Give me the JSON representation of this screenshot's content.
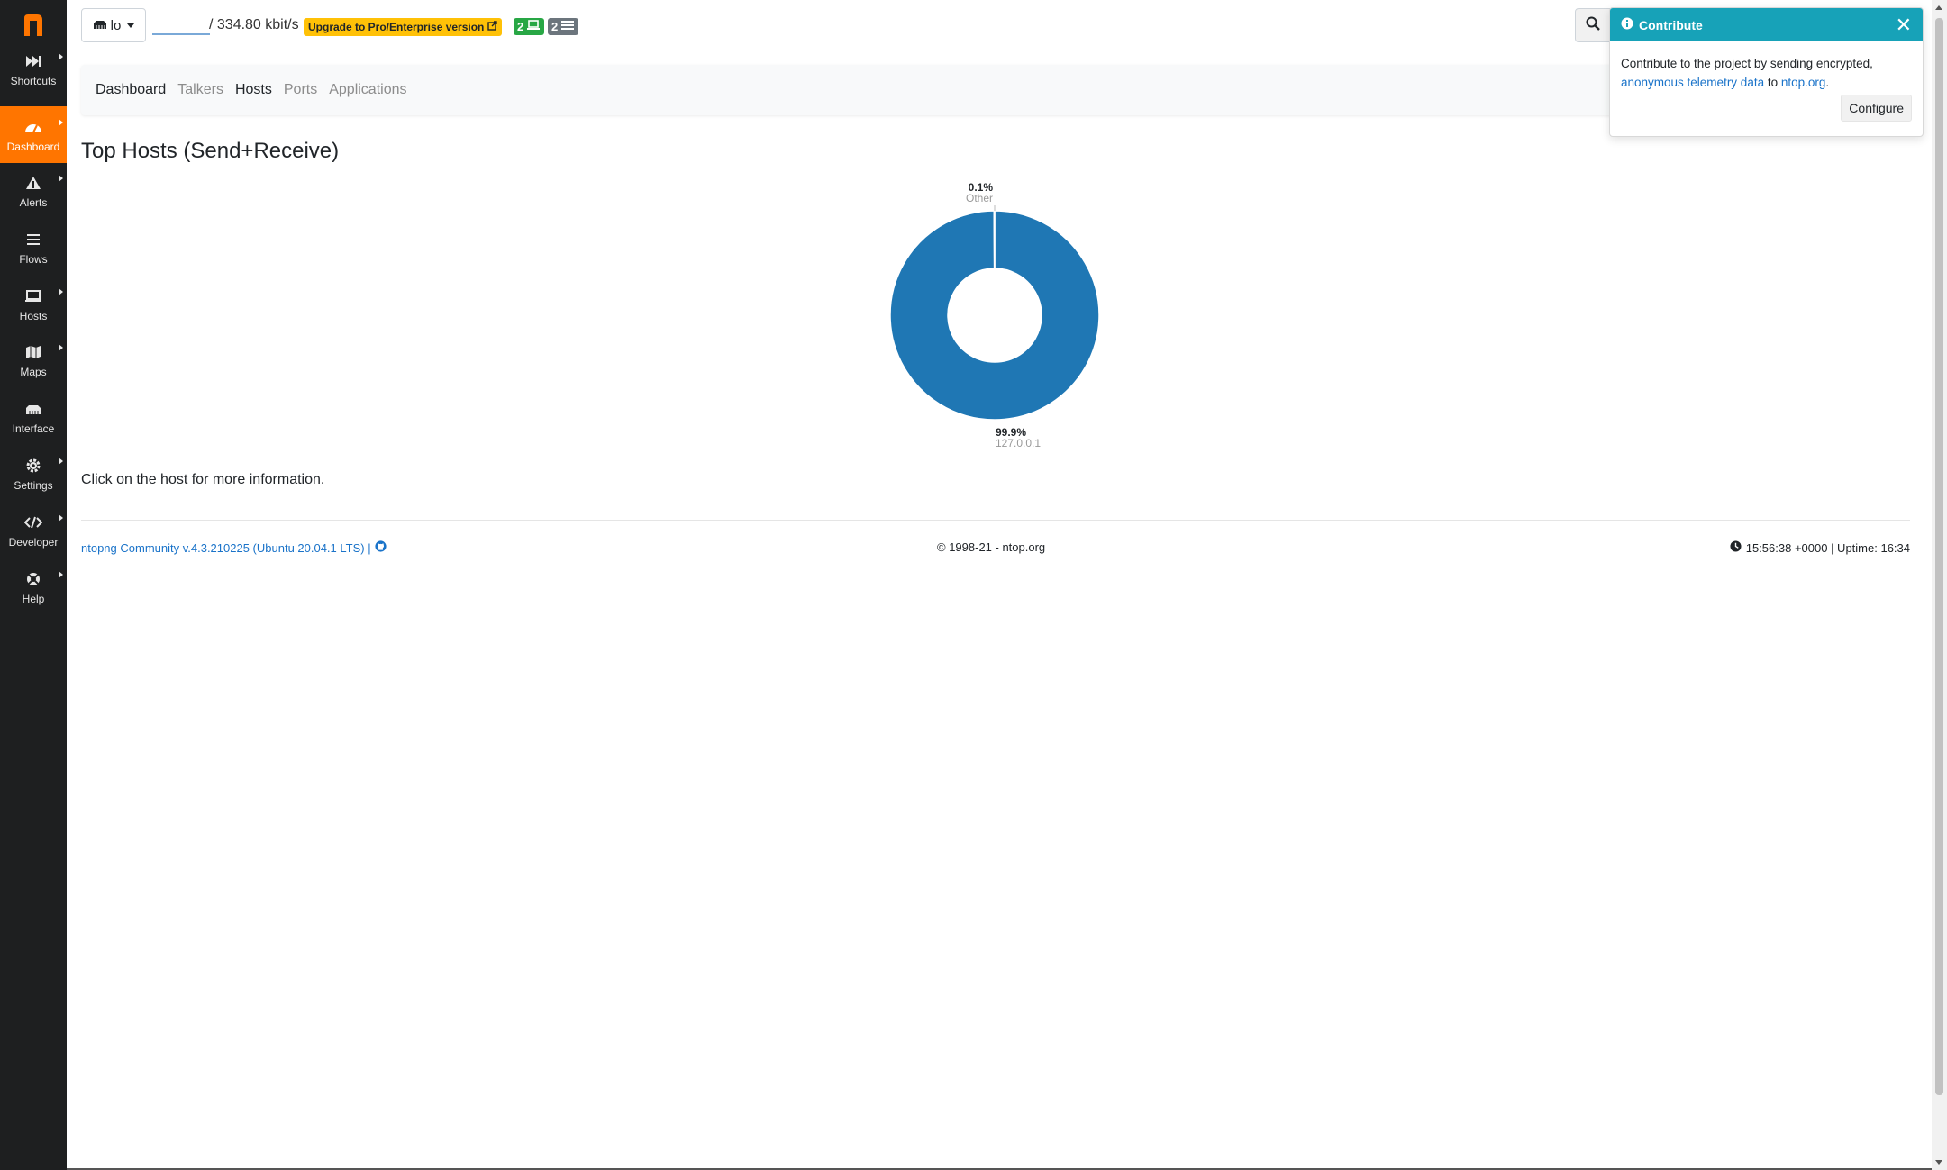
{
  "sidebar": {
    "logo": "n",
    "items": [
      {
        "label": "Shortcuts",
        "icon": "fast-forward-icon",
        "caret": true,
        "active": false
      },
      {
        "label": "Dashboard",
        "icon": "gauge-icon",
        "caret": true,
        "active": true
      },
      {
        "label": "Alerts",
        "icon": "warning-icon",
        "caret": true,
        "active": false
      },
      {
        "label": "Flows",
        "icon": "list-icon",
        "caret": false,
        "active": false
      },
      {
        "label": "Hosts",
        "icon": "laptop-icon",
        "caret": true,
        "active": false
      },
      {
        "label": "Maps",
        "icon": "map-icon",
        "caret": true,
        "active": false
      },
      {
        "label": "Interface",
        "icon": "ethernet-icon",
        "caret": false,
        "active": false
      },
      {
        "label": "Settings",
        "icon": "gear-icon",
        "caret": true,
        "active": false
      },
      {
        "label": "Developer",
        "icon": "code-icon",
        "caret": true,
        "active": false
      },
      {
        "label": "Help",
        "icon": "lifebuoy-icon",
        "caret": true,
        "active": false
      }
    ]
  },
  "topbar": {
    "interface_name": "lo",
    "throughput": "/ 334.80 kbit/s",
    "upgrade_label": "Upgrade to Pro/Enterprise version",
    "hosts_badge": "2",
    "flows_badge": "2"
  },
  "subnav": {
    "tabs": [
      "Dashboard",
      "Talkers",
      "Hosts",
      "Ports",
      "Applications"
    ]
  },
  "main": {
    "title": "Top Hosts (Send+Receive)",
    "hint": "Click on the host for more information."
  },
  "chart_data": {
    "type": "pie",
    "title": "Top Hosts (Send+Receive)",
    "slices": [
      {
        "label": "127.0.0.1",
        "value": 99.9,
        "display": "99.9%"
      },
      {
        "label": "Other",
        "value": 0.1,
        "display": "0.1%"
      }
    ],
    "colors": [
      "#1f77b4",
      "#1f77b4"
    ]
  },
  "footer": {
    "version": "ntopng Community v.4.3.210225 (Ubuntu 20.04.1 LTS) |",
    "copyright": "© 1998-21 - ntop.org",
    "status": "15:56:38 +0000 | Uptime: 16:34"
  },
  "toast": {
    "title": "Contribute",
    "text_before": "Contribute to the project by sending encrypted,",
    "link1": "anonymous telemetry data",
    "text_mid": " to ",
    "link2": "ntop.org",
    "text_after": ".",
    "button": "Configure"
  },
  "colors": {
    "sidebar_bg": "#1e1f20",
    "accent": "#ff7500",
    "toast_header": "#17a2b8",
    "donut": "#1f77b4",
    "upgrade": "#ffc107"
  }
}
